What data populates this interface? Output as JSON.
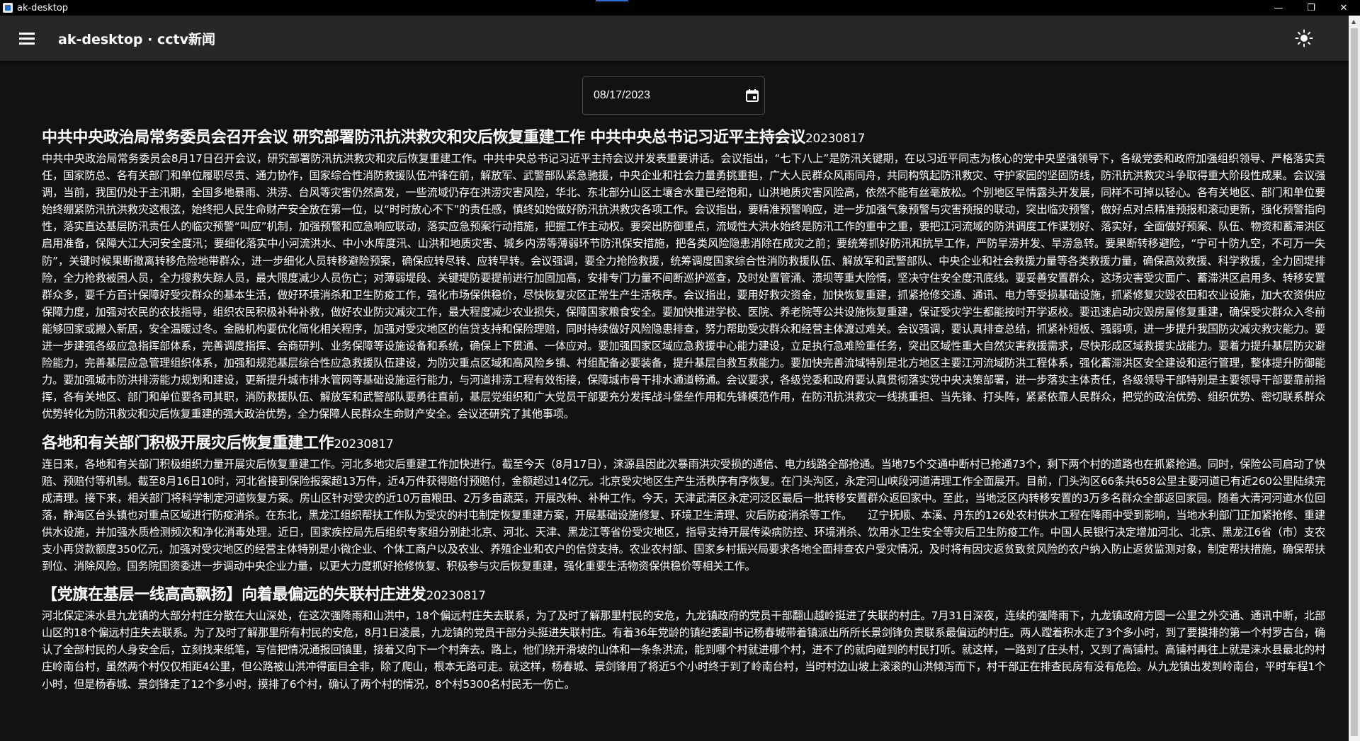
{
  "window": {
    "title": "ak-desktop",
    "controls": {
      "minimize": "—",
      "maximize": "❐",
      "close": "✕"
    }
  },
  "appbar": {
    "title": "ak-desktop · cctv新闻",
    "menu_icon": "hamburger-menu-icon",
    "theme_icon": "sun-icon"
  },
  "date_picker": {
    "value": "08/17/2023",
    "icon": "calendar-icon"
  },
  "articles": [
    {
      "title": "中共中央政治局常务委员会召开会议 研究部署防汛抗洪救灾和灾后恢复重建工作 中共中央总书记习近平主持会议",
      "date": "20230817",
      "body": "中共中央政治局常务委员会8月17日召开会议，研究部署防汛抗洪救灾和灾后恢复重建工作。中共中央总书记习近平主持会议并发表重要讲话。会议指出，“七下八上”是防汛关键期，在以习近平同志为核心的党中央坚强领导下，各级党委和政府加强组织领导、严格落实责任，国家防总、各有关部门和单位履职尽责、通力协作，国家综合性消防救援队伍冲锋在前，解放军、武警部队紧急驰援，中央企业和社会力量勇挑重担，广大人民群众风雨同舟，共同构筑起防汛救灾、守护家园的坚固防线，防汛抗洪救灾斗争取得重大阶段性成果。会议强调，当前，我国仍处于主汛期，全国多地暴雨、洪涝、台风等灾害仍然高发，一些流域仍存在洪涝灾害风险，华北、东北部分山区土壤含水量已经饱和，山洪地质灾害风险高，依然不能有丝毫放松。个别地区旱情露头开发展，同样不可掉以轻心。各有关地区、部门和单位要始终绷紧防汛抗洪救灾这根弦，始终把人民生命财产安全放在第一位，以“时时放心不下”的责任感，慎终如始做好防汛抗洪救灾各项工作。会议指出，要精准预警响应，进一步加强气象预警与灾害预报的联动，突出临灾预警，做好点对点精准预报和滚动更新，强化预警指向性，落实直达基层防汛责任人的临灾预警“叫应”机制，加强预警和应急响应联动，落实应急预案行动措施，把握工作主动权。要突出防御重点，流域性大洪水始终是防汛工作的重中之重，要把江河流域的防洪调度工作谋划好、落实好，全面做好预案、队伍、物资和蓄滞洪区启用准备，保障大江大河安全度汛；要细化落实中小河流洪水、中小水库度汛、山洪和地质灾害、城乡内涝等薄弱环节防汛保安措施，把各类风险隐患消除在成灾之前；要统筹抓好防汛和抗旱工作，严防旱涝并发、旱涝急转。要果断转移避险，“宁可十防九空，不可万一失防”，关键时候果断撤离转移危险地带群众，进一步细化人员转移避险预案，确保应转尽转、应转早转。会议强调，要全力抢险救援，统筹调度国家综合性消防救援队伍、解放军和武警部队、中央企业和社会救援力量等各类救援力量，确保高效救援、科学救援，全力固堤排险，全力抢救被困人员，全力搜救失踪人员，最大限度减少人员伤亡；对薄弱堤段、关键堤防要提前进行加固加高，安排专门力量不间断巡护巡查，及时处置管涌、溃坝等重大险情，坚决守住安全度汛底线。要妥善安置群众，这场灾害受灾面广、蓄滞洪区启用多、转移安置群众多，要千方百计保障好受灾群众的基本生活，做好环境消杀和卫生防疫工作，强化市场保供稳价，尽快恢复灾区正常生产生活秩序。会议指出，要用好救灾资金，加快恢复重建，抓紧抢修交通、通讯、电力等受损基础设施，抓紧修复灾毁农田和农业设施，加大农资供应保障力度，加强对农民的农技指导，组织农民积极补种补救，做好农业防灾减灾工作，最大程度减少农业损失，保障国家粮食安全。要加快推进学校、医院、养老院等公共设施恢复重建，保证受灾学生都能按时开学返校。要迅速启动灾毁房屋修复重建，确保受灾群众入冬前能够回家或搬入新居，安全温暖过冬。金融机构要优化简化相关程序，加强对受灾地区的信贷支持和保险理赔，同时持续做好风险隐患排查，努力帮助受灾群众和经营主体渡过难关。会议强调，要认真排查总结，抓紧补短板、强弱项，进一步提升我国防灾减灾救灾能力。要进一步建强各级应急指挥部体系，完善调度指挥、会商研判、业务保障等设施设备和系统，确保上下贯通、一体应对。要加强国家区域应急救援中心能力建设，立足执行急难险重任务，突出区域性重大自然灾害救援需求，尽快形成区域救援实战能力。要着力提升基层防灾避险能力，完善基层应急管理组织体系，加强和规范基层综合性应急救援队伍建设，为防灾重点区域和高风险乡镇、村组配备必要装备，提升基层自救互救能力。要加快完善流域特别是北方地区主要江河流域防洪工程体系，强化蓄滞洪区安全建设和运行管理，整体提升防御能力。要加强城市防洪排涝能力规划和建设，更新提升城市排水管网等基础设施运行能力，与河道排涝工程有效衔接，保障城市骨干排水通道畅通。会议要求，各级党委和政府要认真贯彻落实党中央决策部署，进一步落实主体责任，各级领导干部特别是主要领导干部要靠前指挥，各有关地区、部门和单位要各司其职，消防救援队伍、解放军和武警部队要勇往直前，基层党组织和广大党员干部要充分发挥战斗堡垒作用和先锋模范作用，在防汛抗洪救灾一线挑重担、当先锋、打头阵，紧紧依靠人民群众，把党的政治优势、组织优势、密切联系群众优势转化为防汛救灾和灾后恢复重建的强大政治优势，全力保障人民群众生命财产安全。会议还研究了其他事项。"
    },
    {
      "title": "各地和有关部门积极开展灾后恢复重建工作",
      "date": "20230817",
      "body": "连日来，各地和有关部门积极组织力量开展灾后恢复重建工作。河北多地灾后重建工作加快进行。截至今天（8月17日），涞源县因此次暴雨洪灾受损的通信、电力线路全部抢通。当地75个交通中断村已抢通73个，剩下两个村的道路也在抓紧抢通。同时，保险公司启动了快赔、预赔付等机制。截至8月16日10时，河北省接到保险报案超13万件，近4万件获得赔付预赔付，金额超过14亿元。北京受灾地区生产生活秩序有序恢复。在门头沟区，永定河山峡段河道清理工作全面展开。目前，门头沟区66条共658公里主要河道已有近260公里陆续完成清理。接下来，相关部门将科学制定河道恢复方案。房山区针对受灾的近10万亩粮田、2万多亩蔬菜，开展改种、补种工作。今天，天津武清区永定河泛区最后一批转移安置群众返回家中。至此，当地泛区内转移安置的3万多名群众全部返回家园。随着大清河河道水位回落，静海区台头镇也对重点区域进行防疫消杀。在东北，黑龙江组织帮扶工作队为受灾的村屯制定恢复重建方案，开展基础设施修复、环境卫生清理、灾后防疫消杀等工作。　　辽宁抚顺、本溪、丹东的126处农村供水工程在降雨中受到影响，当地水利部门正加紧抢修、重建供水设施，并加强水质检测频次和净化消毒处理。近日，国家疾控局先后组织专家组分别赴北京、河北、天津、黑龙江等省份受灾地区，指导支持开展传染病防控、环境消杀、饮用水卫生安全等灾后卫生防疫工作。中国人民银行决定增加河北、北京、黑龙江6省（市）支农支小再贷款额度350亿元，加强对受灾地区的经营主体特别是小微企业、个体工商户以及农业、养殖企业和农户的信贷支持。农业农村部、国家乡村振兴局要求各地全面排查农户受灾情况，及时将有因灾返贫致贫风险的农户纳入防止返贫监测对象，制定帮扶措施，确保帮扶到位、消除风险。国务院国资委进一步调动中央企业力量，以更大力度抓好抢修恢复、积极参与灾后恢复重建，强化重要生活物资保供稳价等相关工作。"
    },
    {
      "title": "【党旗在基层一线高高飘扬】向着最偏远的失联村庄进发",
      "date": "20230817",
      "body": "河北保定涞水县九龙镇的大部分村庄分散在大山深处，在这次强降雨和山洪中，18个偏远村庄失去联系，为了及时了解那里村民的安危，九龙镇政府的党员干部翻山越岭挺进了失联的村庄。7月31日深夜，连续的强降雨下，九龙镇政府方圆一公里之外交通、通讯中断，北部山区的18个偏远村庄失去联系。为了及时了解那里所有村民的安危，8月1日凌晨，九龙镇的党员干部分头挺进失联村庄。有着36年党龄的镇纪委副书记杨春城带着镇派出所所长景剑锋负责联系最偏远的村庄。两人蹚着积水走了3个多小时，到了要摸排的第一个村罗古台，确认了全部村民的人身安全后，立刻找来纸笔，写信把情况通报回镇里，接着又向下一个村奔去。路上，他们绕开滑坡的山体和一条条洪流，能到哪个村就进哪个村，进不了的就向碰到的村民打听。就这样，一路到了庄头村，又到了高铺村。高铺村再往上就是涞水县最北的村庄岭南台村，虽然两个村仅仅相距4公里，但公路被山洪冲得面目全非，除了爬山，根本无路可走。就这样，杨春城、景剑锋用了将近5个小时终于到了岭南台村，当时村边山坡上滚滚的山洪倾泻而下，村干部正在排查民房有没有危险。从九龙镇出发到岭南台，平时车程1个小时，但是杨春城、景剑锋走了12个多小时，摸排了6个村，确认了两个村的情况，8个村5300名村民无一伤亡。"
    }
  ]
}
